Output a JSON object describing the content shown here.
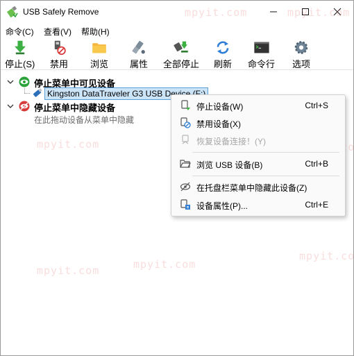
{
  "window": {
    "title": "USB Safely Remove",
    "controls": [
      "minimize",
      "maximize",
      "close"
    ]
  },
  "menubar": {
    "items": [
      {
        "label": "命令(C)"
      },
      {
        "label": "查看(V)"
      },
      {
        "label": "帮助(H)"
      }
    ]
  },
  "toolbar": {
    "buttons": [
      {
        "label": "停止(S)",
        "icon": "stop-green-arrow-icon"
      },
      {
        "label": "禁用",
        "icon": "disable-usb-icon"
      },
      {
        "label": "浏览",
        "icon": "folder-icon"
      },
      {
        "label": "属性",
        "icon": "usb-plug-properties-icon"
      },
      {
        "label": "全部停止",
        "icon": "stop-all-icon"
      },
      {
        "label": "刷新",
        "icon": "refresh-icon"
      },
      {
        "label": "命令行",
        "icon": "terminal-icon"
      },
      {
        "label": "选项",
        "icon": "gear-icon"
      }
    ]
  },
  "tree": {
    "visible_group": {
      "label": "停止菜单中可见设备",
      "icon": "eye-green-icon",
      "devices": [
        {
          "label": "Kingston DataTraveler G3 USB Device (F:)",
          "icon": "usb-stick-icon",
          "selected": true
        }
      ]
    },
    "hidden_group": {
      "label": "停止菜单中隐藏设备",
      "icon": "eye-hidden-red-icon",
      "hint": "在此拖动设备从菜单中隐藏"
    }
  },
  "context_menu": {
    "items": [
      {
        "label": "停止设备(W)",
        "shortcut": "Ctrl+S",
        "icon": "stop-device-icon",
        "enabled": true
      },
      {
        "label": "禁用设备(X)",
        "shortcut": "",
        "icon": "disable-device-icon",
        "enabled": true
      },
      {
        "label": "恢复设备连接！(Y)",
        "shortcut": "",
        "icon": "restore-device-icon",
        "enabled": false
      },
      {
        "label": "浏览 USB 设备(B)",
        "shortcut": "Ctrl+B",
        "icon": "folder-open-icon",
        "enabled": true
      },
      {
        "label": "在托盘栏菜单中隐藏此设备(Z)",
        "shortcut": "",
        "icon": "eye-hide-icon",
        "enabled": true
      },
      {
        "label": "设备属性(P)...",
        "shortcut": "Ctrl+E",
        "icon": "device-properties-icon",
        "enabled": true
      }
    ]
  },
  "watermark": {
    "text": "mpyit.com"
  },
  "colors": {
    "accent_green": "#2aa43a",
    "accent_red": "#d83a3a",
    "selection": "#cce4f7",
    "disabled_text": "#a7a7a7"
  }
}
